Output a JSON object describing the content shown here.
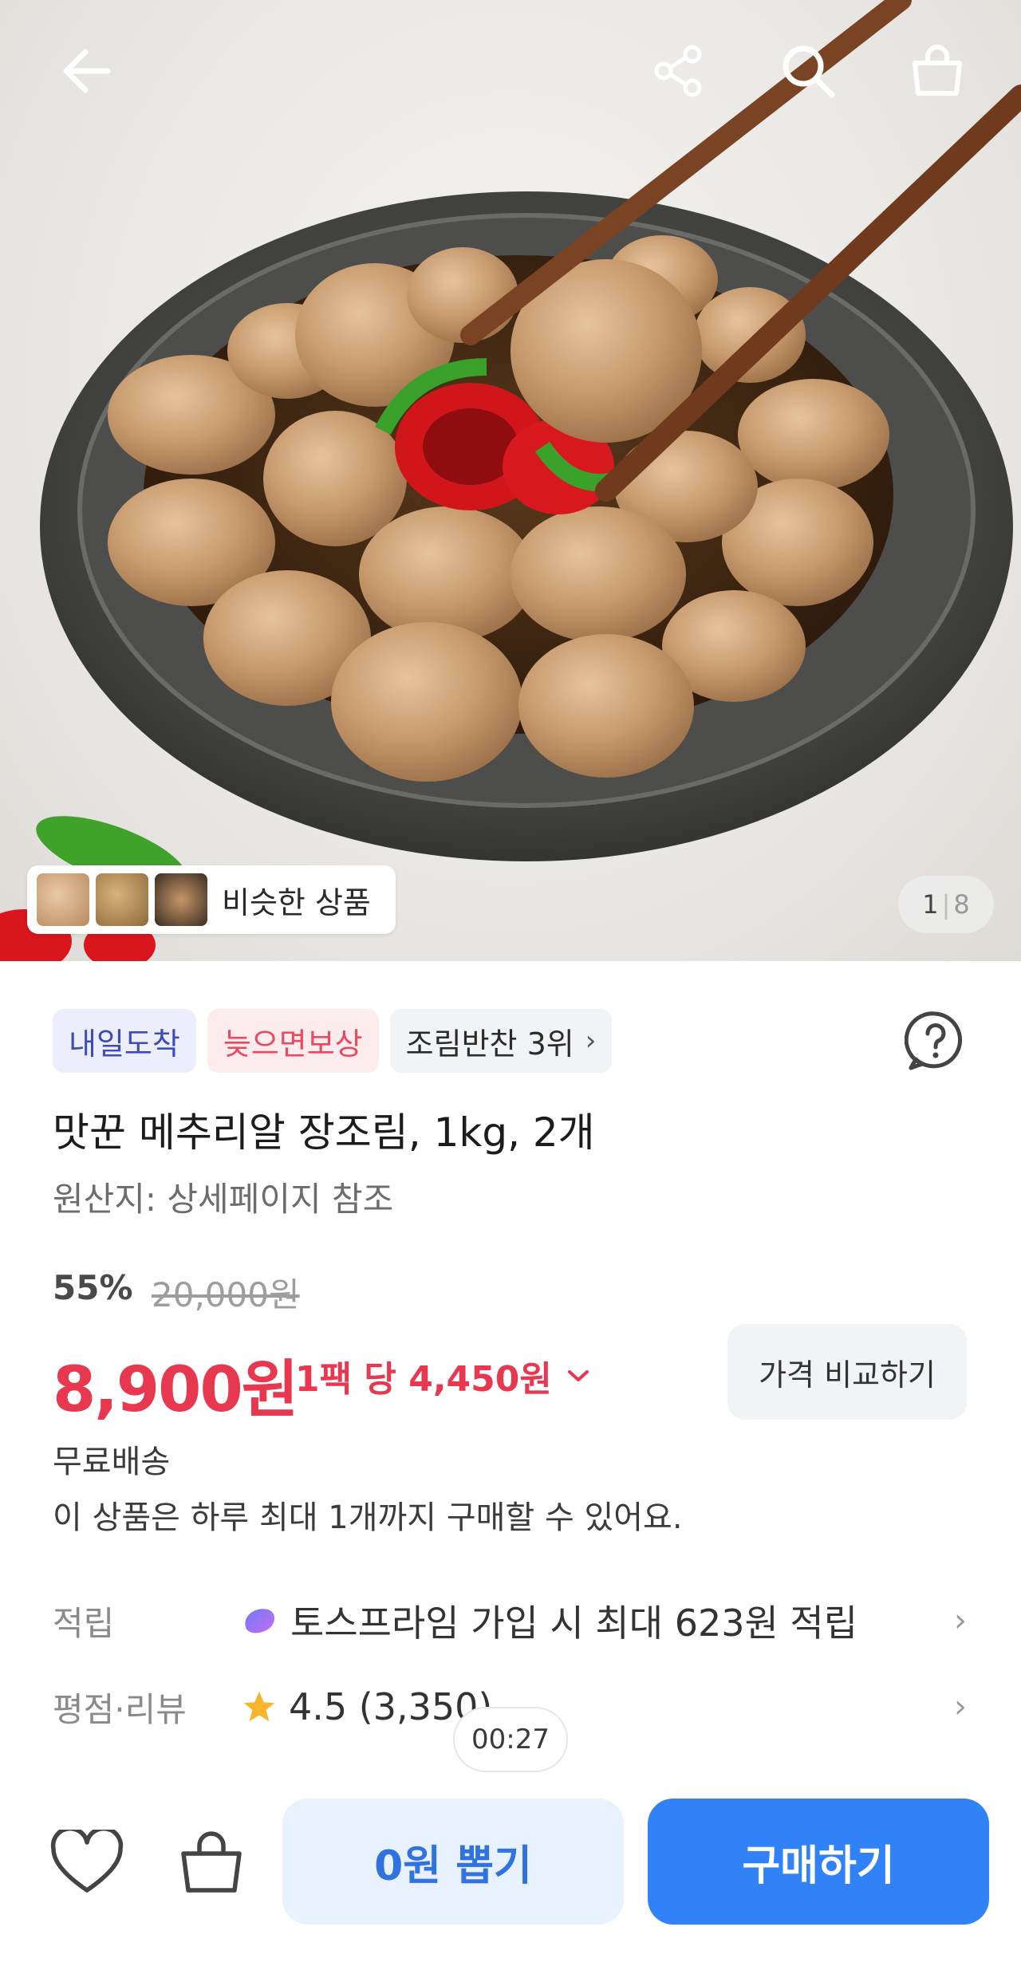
{
  "hero": {
    "similar_label": "비슷한 상품",
    "counter_current": "1",
    "counter_total": "8"
  },
  "badges": {
    "arrival": "내일도착",
    "compensation": "늦으면보상",
    "ranking": "조림반찬 3위"
  },
  "product": {
    "title": "맛꾼 메추리알 장조림, 1kg, 2개",
    "origin": "원산지: 상세페이지 참조"
  },
  "pricing": {
    "discount": "55%",
    "original_price": "20,000원",
    "price": "8,900원",
    "unit_price": "1팩 당 4,450원",
    "compare_label": "가격 비교하기"
  },
  "shipping": "무료배송",
  "purchase_limit": "이 상품은 하루 최대 1개까지 구매할 수 있어요.",
  "rows": {
    "points_label": "적립",
    "points_value": "토스프라임 가입 시 최대 623원 적립",
    "rating_label": "평점·리뷰",
    "rating_value": "4.5 (3,350)"
  },
  "timer": "00:27",
  "bottom": {
    "draw_label": "0원 뽑기",
    "buy_label": "구매하기"
  },
  "colors": {
    "price_red": "#e8384f",
    "primary_blue": "#3182f6",
    "arrival_purple": "#3f4bb8"
  },
  "icons": [
    "back-arrow-icon",
    "share-icon",
    "search-icon",
    "cart-icon",
    "help-icon",
    "toss-prime-icon",
    "star-icon",
    "heart-icon",
    "bag-icon",
    "chevron-right-icon",
    "chevron-down-icon"
  ]
}
